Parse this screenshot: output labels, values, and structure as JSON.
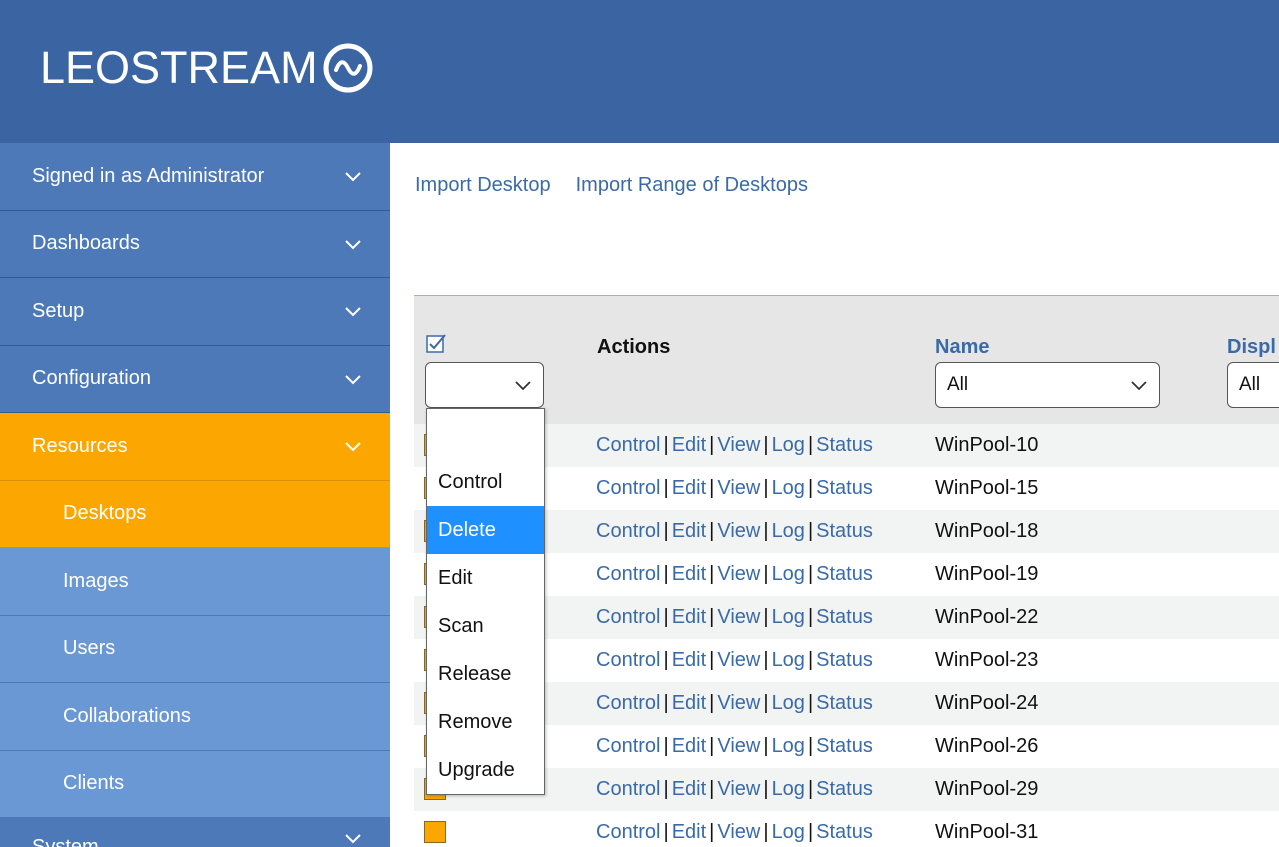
{
  "brand": {
    "logo_text": "LEOSTREAM"
  },
  "sidebar": {
    "items": [
      {
        "label": "Signed in as Administrator",
        "level": "top",
        "active": false
      },
      {
        "label": "Dashboards",
        "level": "top",
        "active": false
      },
      {
        "label": "Setup",
        "level": "top",
        "active": false
      },
      {
        "label": "Configuration",
        "level": "top",
        "active": false
      },
      {
        "label": "Resources",
        "level": "top",
        "active": true
      },
      {
        "label": "Desktops",
        "level": "sub",
        "active": true
      },
      {
        "label": "Images",
        "level": "sub",
        "active": false
      },
      {
        "label": "Users",
        "level": "sub",
        "active": false
      },
      {
        "label": "Collaborations",
        "level": "sub",
        "active": false
      },
      {
        "label": "Clients",
        "level": "sub",
        "active": false
      }
    ],
    "partial_label": "System"
  },
  "toplinks": {
    "import_desktop": "Import Desktop",
    "import_range": "Import Range of Desktops"
  },
  "table": {
    "headers": {
      "actions": "Actions",
      "name": "Name",
      "display": "Displ"
    },
    "filters": {
      "action_value": "",
      "name_value": "All",
      "display_value": "All"
    },
    "row_actions": [
      "Control",
      "Edit",
      "View",
      "Log",
      "Status"
    ],
    "rows": [
      {
        "name": "WinPool-10"
      },
      {
        "name": "WinPool-15"
      },
      {
        "name": "WinPool-18"
      },
      {
        "name": "WinPool-19"
      },
      {
        "name": "WinPool-22"
      },
      {
        "name": "WinPool-23"
      },
      {
        "name": "WinPool-24"
      },
      {
        "name": "WinPool-26"
      },
      {
        "name": "WinPool-29"
      },
      {
        "name": "WinPool-31"
      }
    ]
  },
  "action_dropdown": {
    "options": [
      "",
      "Control",
      "Delete",
      "Edit",
      "Scan",
      "Release",
      "Remove",
      "Upgrade"
    ],
    "highlighted": "Delete"
  },
  "colors": {
    "header_bg": "#3a64a2",
    "sidebar_bg": "#4d79b8",
    "sub_bg": "#6a98d5",
    "active": "#fca701",
    "link": "#3a6aa8",
    "highlight": "#1e90ff"
  }
}
